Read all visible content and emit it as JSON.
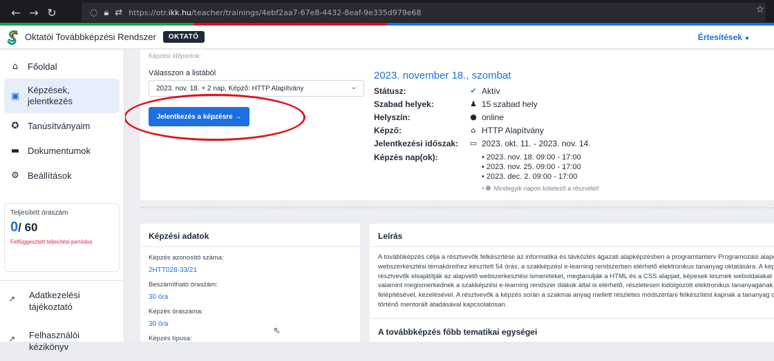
{
  "browser": {
    "url_prefix": "https://otr.",
    "url_host": "ikk.hu",
    "url_path": "/teacher/trainings/4ebf2aa7-67e8-4432-8eaf-9e335d979e68",
    "stripe_colors": [
      "#1aa24b",
      "#e0121d",
      "#1d6fe0",
      "#1d6fe0"
    ]
  },
  "header": {
    "app_title": "Oktatói Továbbképzési Rendszer",
    "role_badge": "OKTATÓ",
    "notifications": "Értesítések"
  },
  "sidebar": {
    "items": [
      {
        "label": "Főoldal",
        "icon": "home-icon"
      },
      {
        "label": "Képzések, jelentkezés",
        "icon": "book-icon"
      },
      {
        "label": "Tanúsítványaim",
        "icon": "award-icon"
      },
      {
        "label": "Dokumentumok",
        "icon": "folder-icon"
      },
      {
        "label": "Beállítások",
        "icon": "gear-icon"
      }
    ],
    "stat_label": "Teljesített óraszám",
    "stat_value": "0",
    "stat_total": "/ 60",
    "stat_warning": "Felfüggesztett teljesítési periódus",
    "links": [
      {
        "label": "Adatkezelési tájékoztató",
        "icon": "external-link-icon"
      },
      {
        "label": "Felhasználói kézikönyv",
        "icon": "external-link-icon"
      }
    ]
  },
  "session": {
    "section_label": "Képzési időpontok:",
    "select_label": "Válasszon a listából",
    "selected_option": "2023. nov. 18. + 2 nap, Képző: HTTP Alapítvány",
    "apply_button": "Jelentkezés a képzésre →",
    "date_title": "2023. november 18., szombat",
    "status_key": "Státusz:",
    "status_value": "Aktív",
    "seats_key": "Szabad helyek:",
    "seats_value": "15 szabad hely",
    "location_key": "Helyszín:",
    "location_value": "online",
    "trainer_key": "Képző:",
    "trainer_value": "HTTP Alapítvány",
    "period_key": "Jelentkezési időszak:",
    "period_value": "2023. okt. 11. - 2023. nov. 14.",
    "days_key": "Képzés nap(ok):",
    "days": [
      "2023. nov. 18. 09:00 - 17:00",
      "2023. nov. 25. 09:00 - 17:00",
      "2023. dec. 2. 09:00 - 17:00"
    ],
    "mandatory_note": "Mindegyik napon kötelező a részvétel!"
  },
  "training_data": {
    "title": "Képzési adatok",
    "fields": [
      {
        "label": "Képzés azonosító száma:",
        "value": "2HTT028-33/21"
      },
      {
        "label": "Beszámítható óraszám:",
        "value": "30 óra"
      },
      {
        "label": "Képzés óraszáma:",
        "value": "30 óra"
      },
      {
        "label": "Képzés típusa:",
        "value": ""
      }
    ]
  },
  "description": {
    "title": "Leírás",
    "lines": [
      "A továbbképzés célja a résztvevők felkészítése az informatika és távközlés ágazati alapképzésben a programtanterv Programozási alapok tan",
      "webszerkesztési témaköreihez készített 54 órás, a szakképzési e-learning rendszerben elérhető elektronikus tananyag oktatására. A képzés",
      "résztvevők elsajátítják az alapvető webszerkesztési ismereteket, megtanulják a HTML és a CSS alapjait, képesek lesznek weboldalakat létre",
      "valamint megismerkednek a szakképzési e-learning rendszer diákok által is elérhető, részletesen kidolgozott elektronikus tananyagának tarta",
      "felépítésével, kezelésével. A résztvevők a képzés során a szakmai anyag mellett részletes módszertani felkészítést kapnak a tananyag diákok",
      "történő mentorált átadásával kapcsolatosan."
    ],
    "topics_title": "A továbbképzés főbb tematikai egységei"
  }
}
